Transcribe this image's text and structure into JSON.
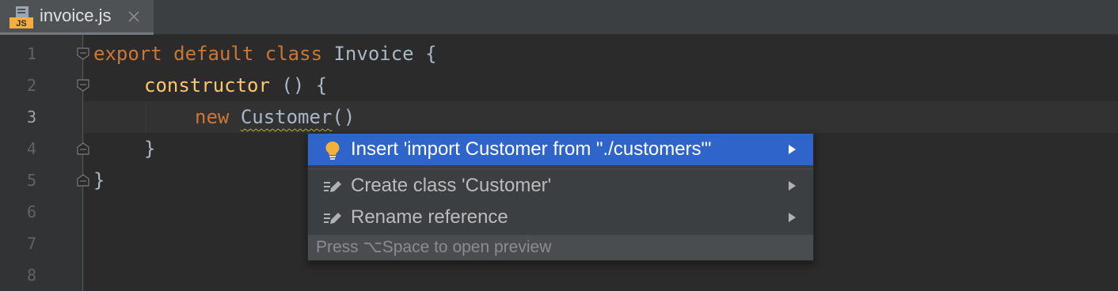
{
  "tab": {
    "filename": "invoice.js",
    "file_icon": "javascript-file-icon",
    "file_icon_badge": "JS",
    "close_icon": "close-icon"
  },
  "gutter": {
    "line_numbers": [
      "1",
      "2",
      "3",
      "4",
      "5",
      "6",
      "7",
      "8"
    ],
    "current_line": "3"
  },
  "code": {
    "line1": {
      "kw1": "export",
      "kw2": "default",
      "kw3": "class",
      "name": "Invoice",
      "brace": "{"
    },
    "line2": {
      "fn": "constructor",
      "rest": "() {"
    },
    "line3": {
      "kw": "new",
      "name": "Customer",
      "rest": "()"
    },
    "line4": {
      "brace": "}"
    },
    "line5": {
      "brace": "}"
    }
  },
  "popup": {
    "items": [
      {
        "label": "Insert 'import Customer from \"./customers\"'",
        "icon": "lightbulb-icon",
        "selected": true
      },
      {
        "label": "Create class 'Customer'",
        "icon": "pencil-edit-icon",
        "selected": false
      },
      {
        "label": "Rename reference",
        "icon": "pencil-edit-icon",
        "selected": false
      }
    ],
    "footer": "Press ⌥Space to open preview"
  },
  "colors": {
    "editor_background": "#2b2b2b",
    "keyword": "#cc7832",
    "function": "#ffc66d",
    "identifier": "#a9b7c6",
    "selection": "#2f65ca",
    "bulb": "#f4af3d"
  }
}
